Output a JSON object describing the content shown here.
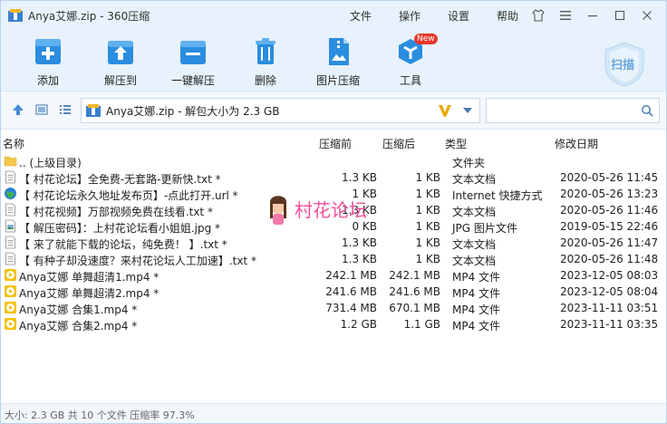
{
  "window": {
    "title": "Anya艾娜.zip - 360压缩",
    "menu": [
      "文件",
      "操作",
      "设置",
      "帮助"
    ]
  },
  "toolbar": {
    "buttons": [
      {
        "label": "添加",
        "icon": "add-icon"
      },
      {
        "label": "解压到",
        "icon": "extract-to-icon"
      },
      {
        "label": "一键解压",
        "icon": "one-click-extract-icon"
      },
      {
        "label": "删除",
        "icon": "delete-icon"
      },
      {
        "label": "图片压缩",
        "icon": "image-compress-icon"
      },
      {
        "label": "工具",
        "icon": "tools-icon"
      }
    ],
    "new_badge": "New",
    "scan_label": "扫描"
  },
  "nav": {
    "path": "Anya艾娜.zip - 解包大小为 2.3 GB",
    "search_placeholder": ""
  },
  "columns": {
    "name": "名称",
    "compressed": "压缩前",
    "packed": "压缩后",
    "type": "类型",
    "modified": "修改日期"
  },
  "files": [
    {
      "name": ".. (上级目录)",
      "before": "",
      "after": "",
      "type": "文件夹",
      "date": "",
      "icon": "folder-icon"
    },
    {
      "name": "【 村花论坛】全免费-无套路-更新快.txt *",
      "before": "1.3 KB",
      "after": "1 KB",
      "type": "文本文档",
      "date": "2020-05-26 11:45",
      "icon": "text-file-icon"
    },
    {
      "name": "【 村花论坛永久地址发布页】-点此打开.url *",
      "before": "1 KB",
      "after": "1 KB",
      "type": "Internet 快捷方式",
      "date": "2020-05-26 13:23",
      "icon": "internet-shortcut-icon"
    },
    {
      "name": "【 村花视频】万部视频免费在线看.txt *",
      "before": "1.3 KB",
      "after": "1 KB",
      "type": "文本文档",
      "date": "2020-05-26 11:46",
      "icon": "text-file-icon"
    },
    {
      "name": "【 解压密码】：上村花论坛看小姐姐.jpg *",
      "before": "0 KB",
      "after": "1 KB",
      "type": "JPG 图片文件",
      "date": "2019-05-15 22:46",
      "icon": "image-file-icon"
    },
    {
      "name": "【 来了就能下载的论坛，纯免费！ 】.txt *",
      "before": "1.3 KB",
      "after": "1 KB",
      "type": "文本文档",
      "date": "2020-05-26 11:47",
      "icon": "text-file-icon"
    },
    {
      "name": "【 有种子却没速度？来村花论坛人工加速】.txt *",
      "before": "1.3 KB",
      "after": "1 KB",
      "type": "文本文档",
      "date": "2020-05-26 11:48",
      "icon": "text-file-icon"
    },
    {
      "name": "Anya艾娜 单舞超清1.mp4 *",
      "before": "242.1 MB",
      "after": "242.1 MB",
      "type": "MP4 文件",
      "date": "2023-12-05 08:03",
      "icon": "video-file-icon"
    },
    {
      "name": "Anya艾娜 单舞超清2.mp4 *",
      "before": "241.6 MB",
      "after": "241.6 MB",
      "type": "MP4 文件",
      "date": "2023-12-05 08:04",
      "icon": "video-file-icon"
    },
    {
      "name": "Anya艾娜 合集1.mp4 *",
      "before": "731.4 MB",
      "after": "670.1 MB",
      "type": "MP4 文件",
      "date": "2023-11-11 03:51",
      "icon": "video-file-icon"
    },
    {
      "name": "Anya艾娜 合集2.mp4 *",
      "before": "1.2 GB",
      "after": "1.1 GB",
      "type": "MP4 文件",
      "date": "2023-11-11 03:35",
      "icon": "video-file-icon"
    }
  ],
  "status": "大小: 2.3 GB 共 10 个文件 压缩率 97.3%",
  "watermark": "村花论坛",
  "colors": {
    "accent": "#2a8de0",
    "toolbar_bg": "#e8f2fc",
    "new_badge": "#e8382c",
    "video_icon": "#f2c200"
  }
}
